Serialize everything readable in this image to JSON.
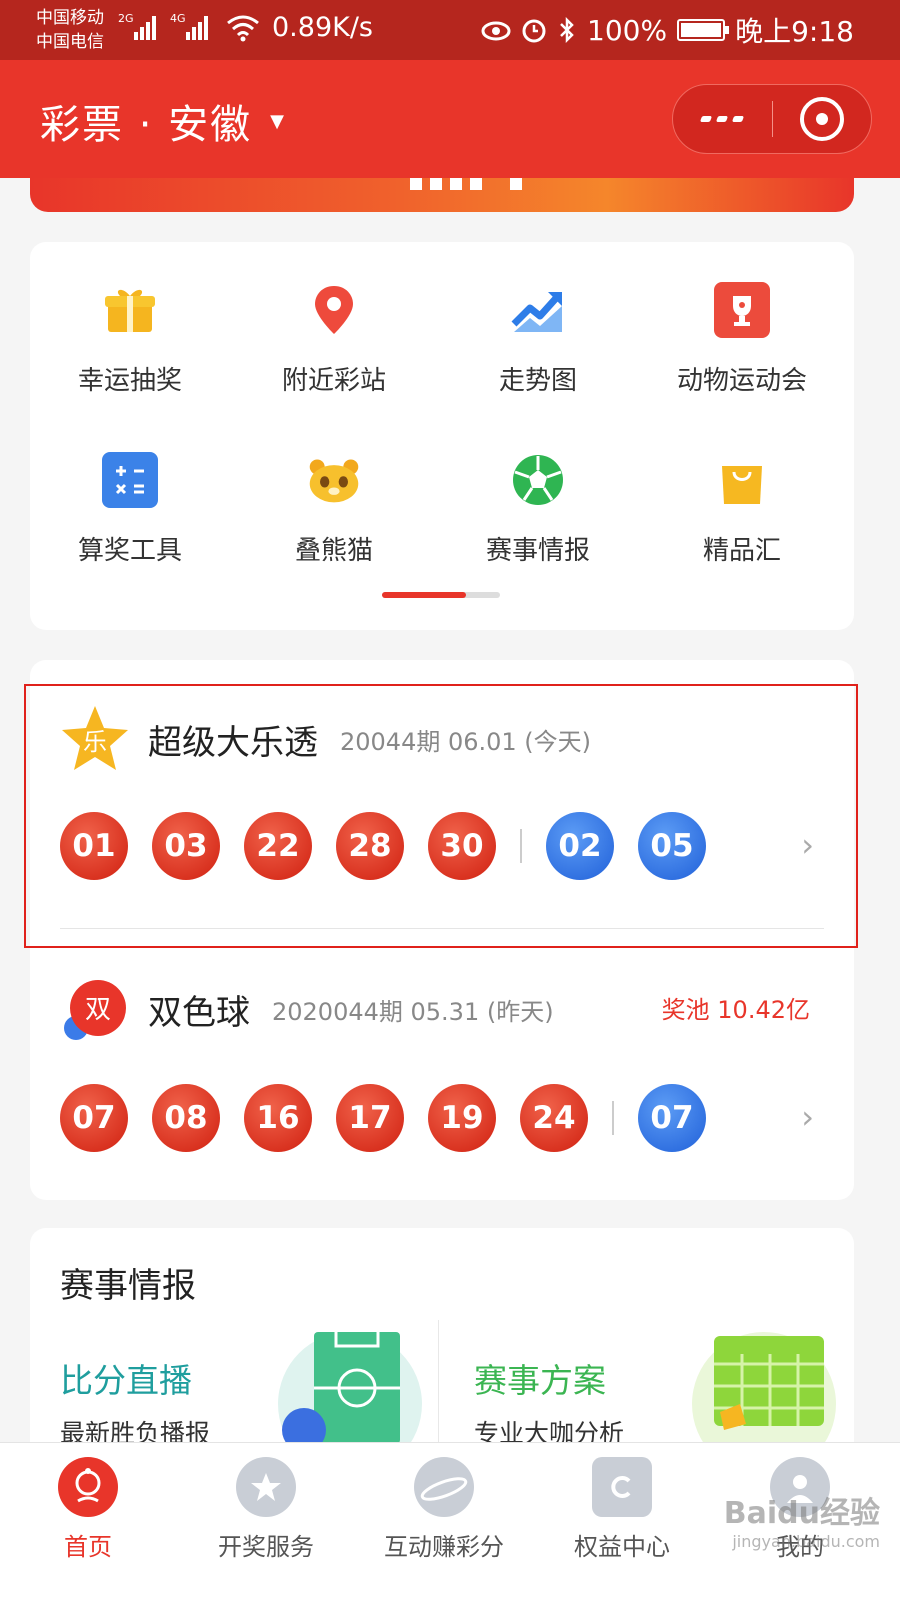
{
  "status_bar": {
    "carrier_1": "中国移动",
    "carrier_2": "中国电信",
    "net_1": "2G",
    "net_2": "4G",
    "net_speed": "0.89K/s",
    "battery": "100%",
    "time": "晚上9:18"
  },
  "header": {
    "title": "彩票 · 安徽",
    "dropdown_icon": "triangle-down-icon",
    "colors": {
      "header_bg": "#e8352a",
      "status_bg": "#b5261e"
    }
  },
  "quick_menu": {
    "items": [
      {
        "label": "幸运抽奖",
        "icon": "gift-icon",
        "color": "#f5b51f"
      },
      {
        "label": "附近彩站",
        "icon": "location-pin-icon",
        "color": "#ee4a3c"
      },
      {
        "label": "走势图",
        "icon": "trend-chart-icon",
        "color": "#2e7de8"
      },
      {
        "label": "动物运动会",
        "icon": "trophy-icon",
        "color": "#ec4b3c"
      },
      {
        "label": "算奖工具",
        "icon": "calculator-icon",
        "color": "#3b82e8"
      },
      {
        "label": "叠熊猫",
        "icon": "panda-icon",
        "color": "#f7c02d"
      },
      {
        "label": "赛事情报",
        "icon": "soccer-ball-icon",
        "color": "#2fb552"
      },
      {
        "label": "精品汇",
        "icon": "shopping-bag-icon",
        "color": "#f6b821"
      }
    ],
    "page_indicator": {
      "current": 1,
      "total": 2
    }
  },
  "lotteries": [
    {
      "name": "超级大乐透",
      "logo_text": "乐",
      "meta": "20044期  06.01  (今天)",
      "jackpot": "",
      "red_balls": [
        "01",
        "03",
        "22",
        "28",
        "30"
      ],
      "blue_balls": [
        "02",
        "05"
      ]
    },
    {
      "name": "双色球",
      "logo_text": "双",
      "meta": "2020044期  05.31  (昨天)",
      "jackpot": "奖池 10.42亿",
      "red_balls": [
        "07",
        "08",
        "16",
        "17",
        "19",
        "24"
      ],
      "blue_balls": [
        "07"
      ]
    }
  ],
  "news": {
    "title": "赛事情报",
    "left": {
      "title": "比分直播",
      "desc": "最新胜负播报",
      "color": "#1f9e9e"
    },
    "right": {
      "title": "赛事方案",
      "desc": "专业大咖分析",
      "color": "#3bb552"
    }
  },
  "tabbar": {
    "tabs": [
      {
        "label": "首页",
        "icon": "home-mascot-icon",
        "active": true
      },
      {
        "label": "开奖服务",
        "icon": "prize-badge-icon",
        "active": false
      },
      {
        "label": "互动赚彩分",
        "icon": "planet-icon",
        "active": false
      },
      {
        "label": "权益中心",
        "icon": "medal-icon",
        "active": false
      },
      {
        "label": "我的",
        "icon": "user-icon",
        "active": false
      }
    ]
  },
  "watermark": {
    "brand": "Baidu经验",
    "url": "jingyan.baidu.com"
  }
}
